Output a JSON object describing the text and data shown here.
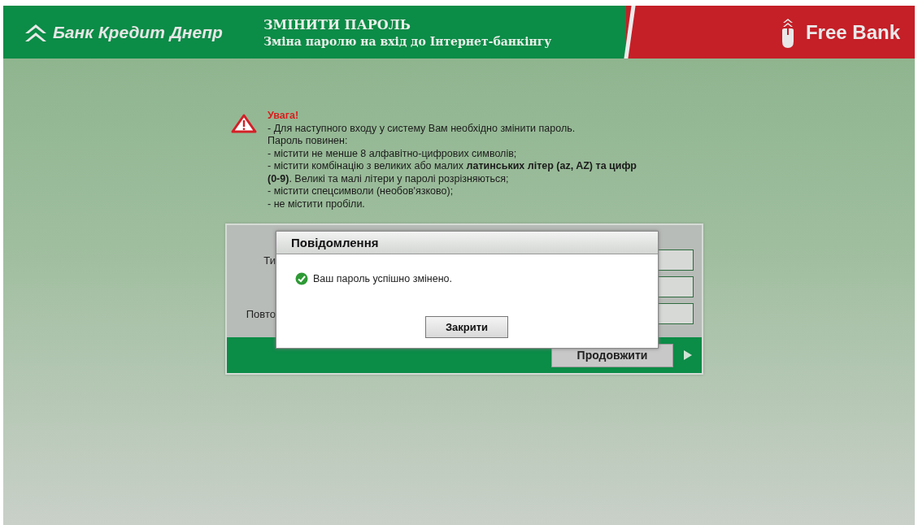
{
  "header": {
    "bank_name": "Банк Кредит Днепр",
    "title": "ЗМІНИТИ ПАРОЛЬ",
    "subtitle": "Зміна паролю на вхід до Інтернет-банкінгу",
    "partner_name": "Free Bank"
  },
  "warning": {
    "heading": "Увага!",
    "lines": [
      "- Для наступного входу у систему Вам необхідно змінити пароль.",
      "Пароль повинен:",
      "- містити не менше 8 алфавітно-цифрових символів;",
      "- містити комбінацію з великих або малих **латинських літер (az, AZ) та цифр (0-9)**. Великі та малі літери у паролі розрізняються;",
      "- містити спецсимволи (необов'язково);",
      "- не містити пробіли."
    ]
  },
  "form": {
    "fields": [
      {
        "kind": "password",
        "label": "Ти"
      },
      {
        "kind": "password"
      },
      {
        "kind": "password",
        "label": "Повто"
      }
    ],
    "submit": "Продовжити"
  },
  "dialog": {
    "title": "Повідомлення",
    "message": "Ваш пароль успішно змінено.",
    "button": "Закрити"
  }
}
